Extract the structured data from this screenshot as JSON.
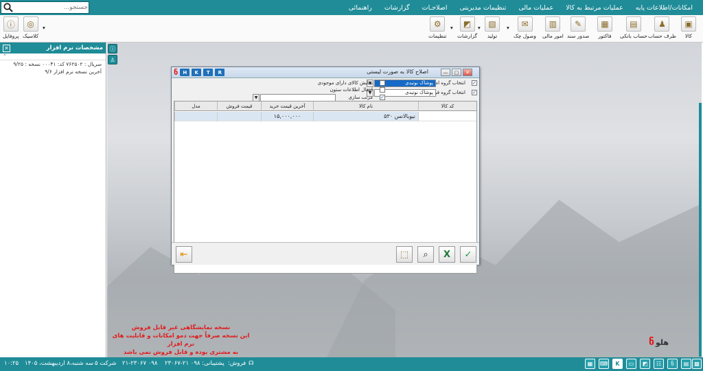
{
  "menu": [
    "امکانات/اطلاعات پایه",
    "عملیات مرتبط به کالا",
    "عملیات مالی",
    "تنظیمات مدیریتی",
    "اصلاحـات",
    "گزارشات",
    "راهنمائی"
  ],
  "search": {
    "placeholder": "جستجو..."
  },
  "toolbar": {
    "items": [
      "کالا",
      "طرف حساب",
      "حساب بانکی",
      "فاکتور",
      "صدور سند",
      "امور مالی",
      "وصول چک",
      "تولید",
      "گزارشات",
      "تنظیمات"
    ],
    "right_items": [
      "کلاسیک",
      "پروفایل"
    ]
  },
  "left_panel": {
    "title": "مشخصات نرم افزار",
    "lines": [
      "سریال : ۷۶۲۵۰۲ کد: ۰۰۰۴۱ نسخه : ۹/۲۵",
      "آخرین نسخه نرم افزار ۹/۶"
    ]
  },
  "dialog": {
    "caption": "اصلاح کالا به صورت لیستی",
    "hotkeys": [
      "H",
      "K",
      "T",
      "R"
    ],
    "main_group_label": "انتخاب گروه اصلی",
    "main_group_value": "پوشاک نوتیدی",
    "sub_group_label": "انتخاب گروه فرعی",
    "sub_group_value": "پوشاک نوتیدی",
    "show_stock_label": "نمایش کالای دارای موجودی",
    "transfer_label": "انتقال اطلاعات ستون",
    "sort_label": "مرتب سازی",
    "columns": [
      "کد کالا",
      "نام کالا",
      "آخرین قیمت خرید",
      "قیمت فروش",
      "مدل"
    ],
    "rows": [
      {
        "code": "",
        "name": "نیوبالانس ۵۳۰",
        "last_price": "۱۵,۰۰۰,۰۰۰",
        "sale_price": "",
        "model": ""
      }
    ]
  },
  "demo_note": [
    "نسخه نمایشگاهی غیر قابل فروش",
    "این نسخه صرفاً جهت دمو امکانات و قابلیت های نرم افزار",
    "به مشتری بوده و قابل فروش نمی باشد"
  ],
  "brand": "هلو",
  "status": {
    "sales": "فروش:",
    "sales_phone": "۰۹۸ ۲۱-۲۳۰۶۷",
    "support": "پشتیبانی: ۰۹۸ ۲۱-۲۳۰۶۷",
    "company": "شرکت ۵",
    "date": "سه شنبه،۸ اردیبهشت، ۱۴۰۵",
    "time": "۱۰:۲۵"
  },
  "colors": {
    "accent": "#1f8c98",
    "selection": "#1569c7",
    "warning": "#e01a1a"
  }
}
